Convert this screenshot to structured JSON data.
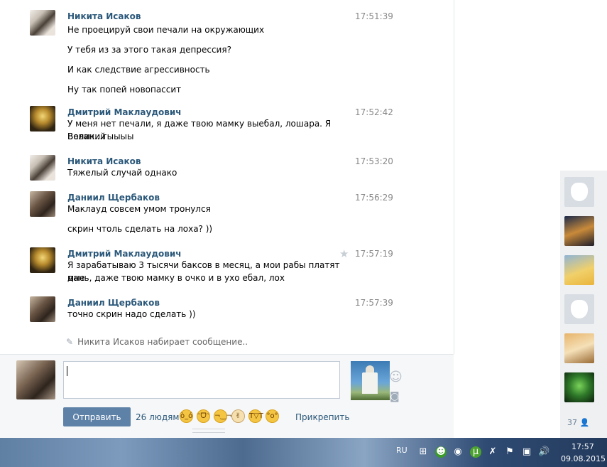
{
  "messages": [
    {
      "author": "Никита Исаков",
      "time": "17:51:39",
      "avatar": "nikita",
      "starred": false,
      "lines": [
        "Не проецируй свои печали на окружающих",
        "У тебя из за этого такая депрессия?",
        "И как следствие агрессивность",
        "Ну так попей новопассит"
      ]
    },
    {
      "author": "Дмитрий Маклаудович",
      "time": "17:52:42",
      "avatar": "dmitry",
      "starred": false,
      "lines": [
        "У меня нет печали, я даже твою мамку выебал, лошара. Я Великий",
        "Вован...гыыыы"
      ]
    },
    {
      "author": "Никита Исаков",
      "time": "17:53:20",
      "avatar": "nikita",
      "starred": false,
      "lines": [
        "Тяжелый случай однако"
      ]
    },
    {
      "author": "Даниил Щербаков",
      "time": "17:56:29",
      "avatar": "daniil",
      "starred": false,
      "lines": [
        "Маклауд совсем умом тронулся",
        "скрин чтоль сделать на лоха? ))"
      ]
    },
    {
      "author": "Дмитрий Маклаудович",
      "time": "17:57:19",
      "avatar": "dmitry",
      "starred": true,
      "lines": [
        "Я зарабатываю 3 тысячи баксов в месяц, а мои рабы платят мне",
        "дань, даже твою мамку в очко и в ухо ебал, лох"
      ]
    },
    {
      "author": "Даниил Щербаков",
      "time": "17:57:39",
      "avatar": "daniil",
      "starred": false,
      "lines": [
        "точно скрин надо сделать ))"
      ]
    }
  ],
  "typing_status": "Никита Исаков набирает сообщение..",
  "compose": {
    "input_value": "",
    "send_label": "Отправить",
    "people_count": "26 людям",
    "attach_label": "Прикрепить",
    "emoji_icons": [
      "angry-face-icon",
      "grin-face-icon",
      "smirk-face-icon",
      "victory-hand-icon",
      "crying-laugh-icon",
      "fearful-face-icon"
    ]
  },
  "friends": {
    "online_count": "37"
  },
  "taskbar": {
    "language": "RU",
    "time": "17:57",
    "date": "09.08.2015"
  }
}
